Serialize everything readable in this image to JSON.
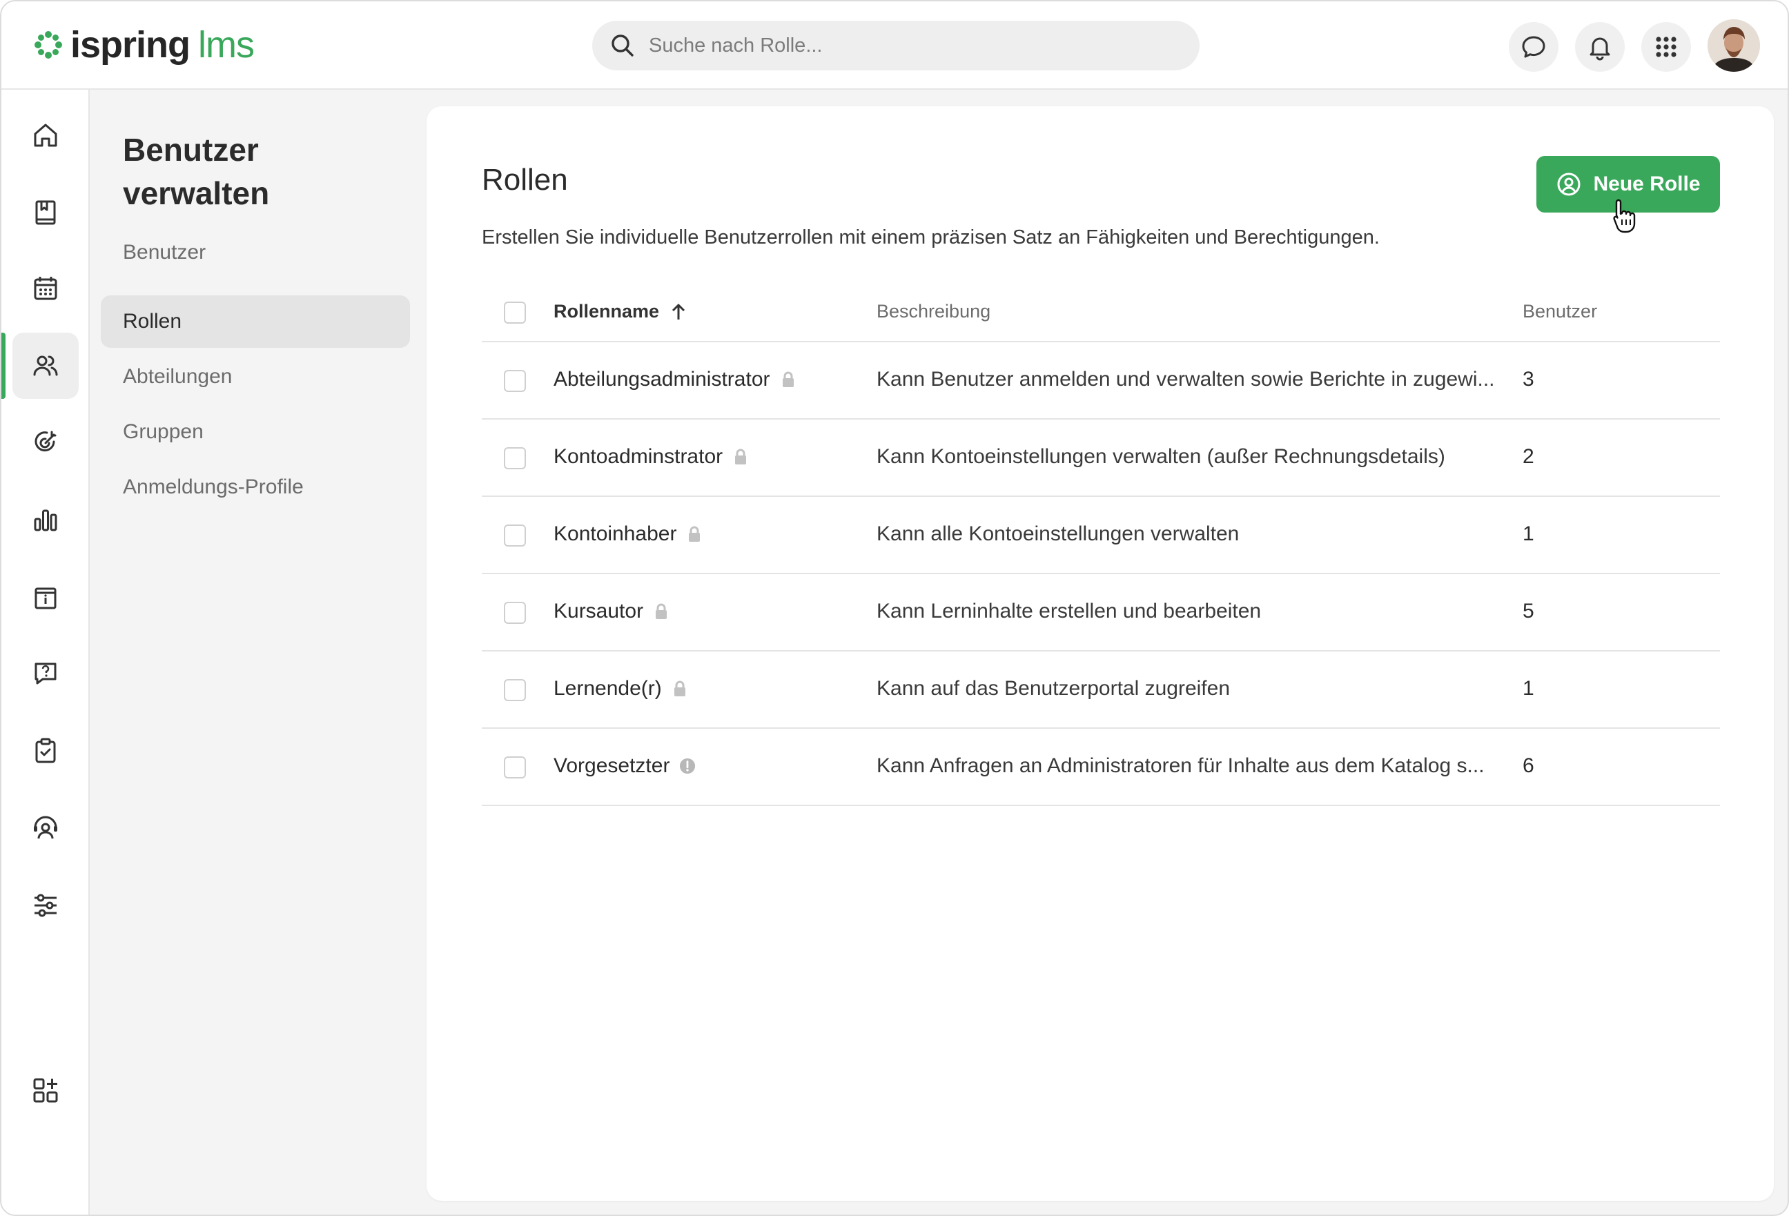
{
  "brand": {
    "name": "ispring",
    "suffix": "lms",
    "accent": "#3aa85b"
  },
  "search": {
    "placeholder": "Suche nach Rolle..."
  },
  "topbar": {
    "icons": [
      "chat-icon",
      "bell-icon",
      "apps-grid-icon"
    ]
  },
  "rail": {
    "items": [
      "home-icon",
      "library-icon",
      "calendar-icon",
      "users-icon",
      "goals-icon",
      "reports-icon",
      "info-board-icon",
      "help-icon",
      "assignments-icon",
      "support-icon",
      "settings-icon",
      "add-apps-icon"
    ],
    "active": "users-icon"
  },
  "subnav": {
    "title_line1": "Benutzer",
    "title_line2": "verwalten",
    "items": [
      {
        "label": "Benutzer"
      },
      {
        "label": "Rollen"
      },
      {
        "label": "Abteilungen"
      },
      {
        "label": "Gruppen"
      },
      {
        "label": "Anmeldungs-Profile"
      }
    ],
    "active_index": 1
  },
  "main": {
    "title": "Rollen",
    "description": "Erstellen Sie individuelle Benutzerrollen mit einem präzisen Satz an Fähigkeiten und Berechtigungen.",
    "new_button": "Neue Rolle",
    "columns": {
      "name": "Rollenname",
      "description": "Beschreibung",
      "users": "Benutzer"
    },
    "rows": [
      {
        "name": "Abteilungsadministrator",
        "icon": "lock-icon",
        "description": "Kann Benutzer anmelden und verwalten sowie Berichte in zugewi...",
        "users": "3"
      },
      {
        "name": "Kontoadminstrator",
        "icon": "lock-icon",
        "description": "Kann Kontoeinstellungen verwalten (außer Rechnungsdetails)",
        "users": "2"
      },
      {
        "name": "Kontoinhaber",
        "icon": "lock-icon",
        "description": "Kann alle Kontoeinstellungen verwalten",
        "users": "1"
      },
      {
        "name": "Kursautor",
        "icon": "lock-icon",
        "description": "Kann Lerninhalte erstellen und bearbeiten",
        "users": "5"
      },
      {
        "name": "Lernende(r)",
        "icon": "lock-icon",
        "description": "Kann auf das Benutzerportal zugreifen",
        "users": "1"
      },
      {
        "name": "Vorgesetzter",
        "icon": "warning-info-icon",
        "description": "Kann Anfragen an Administratoren für Inhalte aus dem Katalog s...",
        "users": "6"
      }
    ]
  }
}
